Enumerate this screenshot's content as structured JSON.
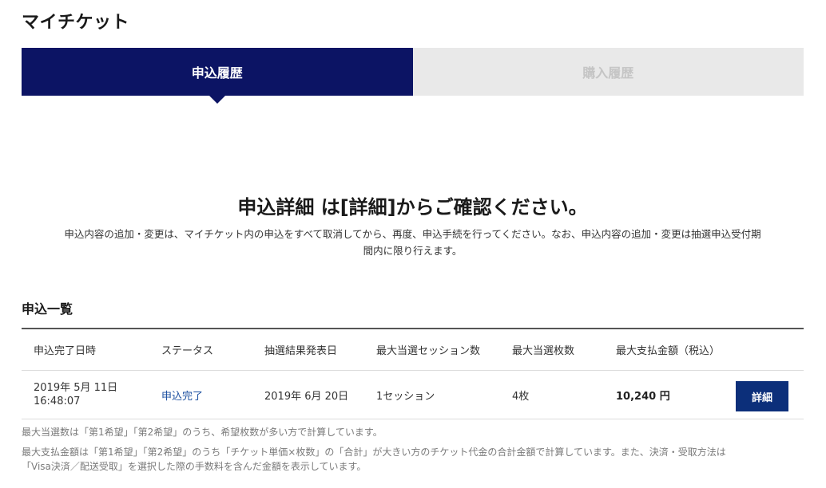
{
  "page": {
    "title": "マイチケット"
  },
  "tabs": [
    {
      "label": "申込履歴",
      "active": true
    },
    {
      "label": "購入履歴",
      "active": false
    }
  ],
  "main": {
    "headline": "申込詳細 は[詳細]からご確認ください。",
    "description_line1": "申込内容の追加・変更は、マイチケット内の申込をすべて取消してから、再度、申込手続を行ってください。なお、申込内容の追加・変更は抽選申込受付期",
    "description_line2": "間内に限り行えます。"
  },
  "list": {
    "title": "申込一覧",
    "columns": [
      "申込完了日時",
      "ステータス",
      "抽選結果発表日",
      "最大当選セッション数",
      "最大当選枚数",
      "最大支払金額（税込）"
    ],
    "rows": [
      {
        "date": "2019年 5月 11日",
        "time": "16:48:07",
        "status": "申込完了",
        "result_date": "2019年 6月 20日",
        "sessions": "1セッション",
        "tickets": "4枚",
        "amount": "10,240 円",
        "detail_label": "詳細"
      }
    ]
  },
  "notes": {
    "note1": "最大当選数は「第1希望」「第2希望」のうち、希望枚数が多い方で計算しています。",
    "note2_line1": "最大支払金額は「第1希望」「第2希望」のうち「チケット単価×枚数」の「合計」が大きい方のチケット代金の合計金額で計算しています。また、決済・受取方法は",
    "note2_line2": "「Visa決済／配送受取」を選択した際の手数料を含んだ金額を表示しています。"
  },
  "colors": {
    "navy": "#0c1464",
    "button": "#0c2f7a",
    "link": "#1b4fa0",
    "inactive_tab": "#e9e9e9"
  }
}
